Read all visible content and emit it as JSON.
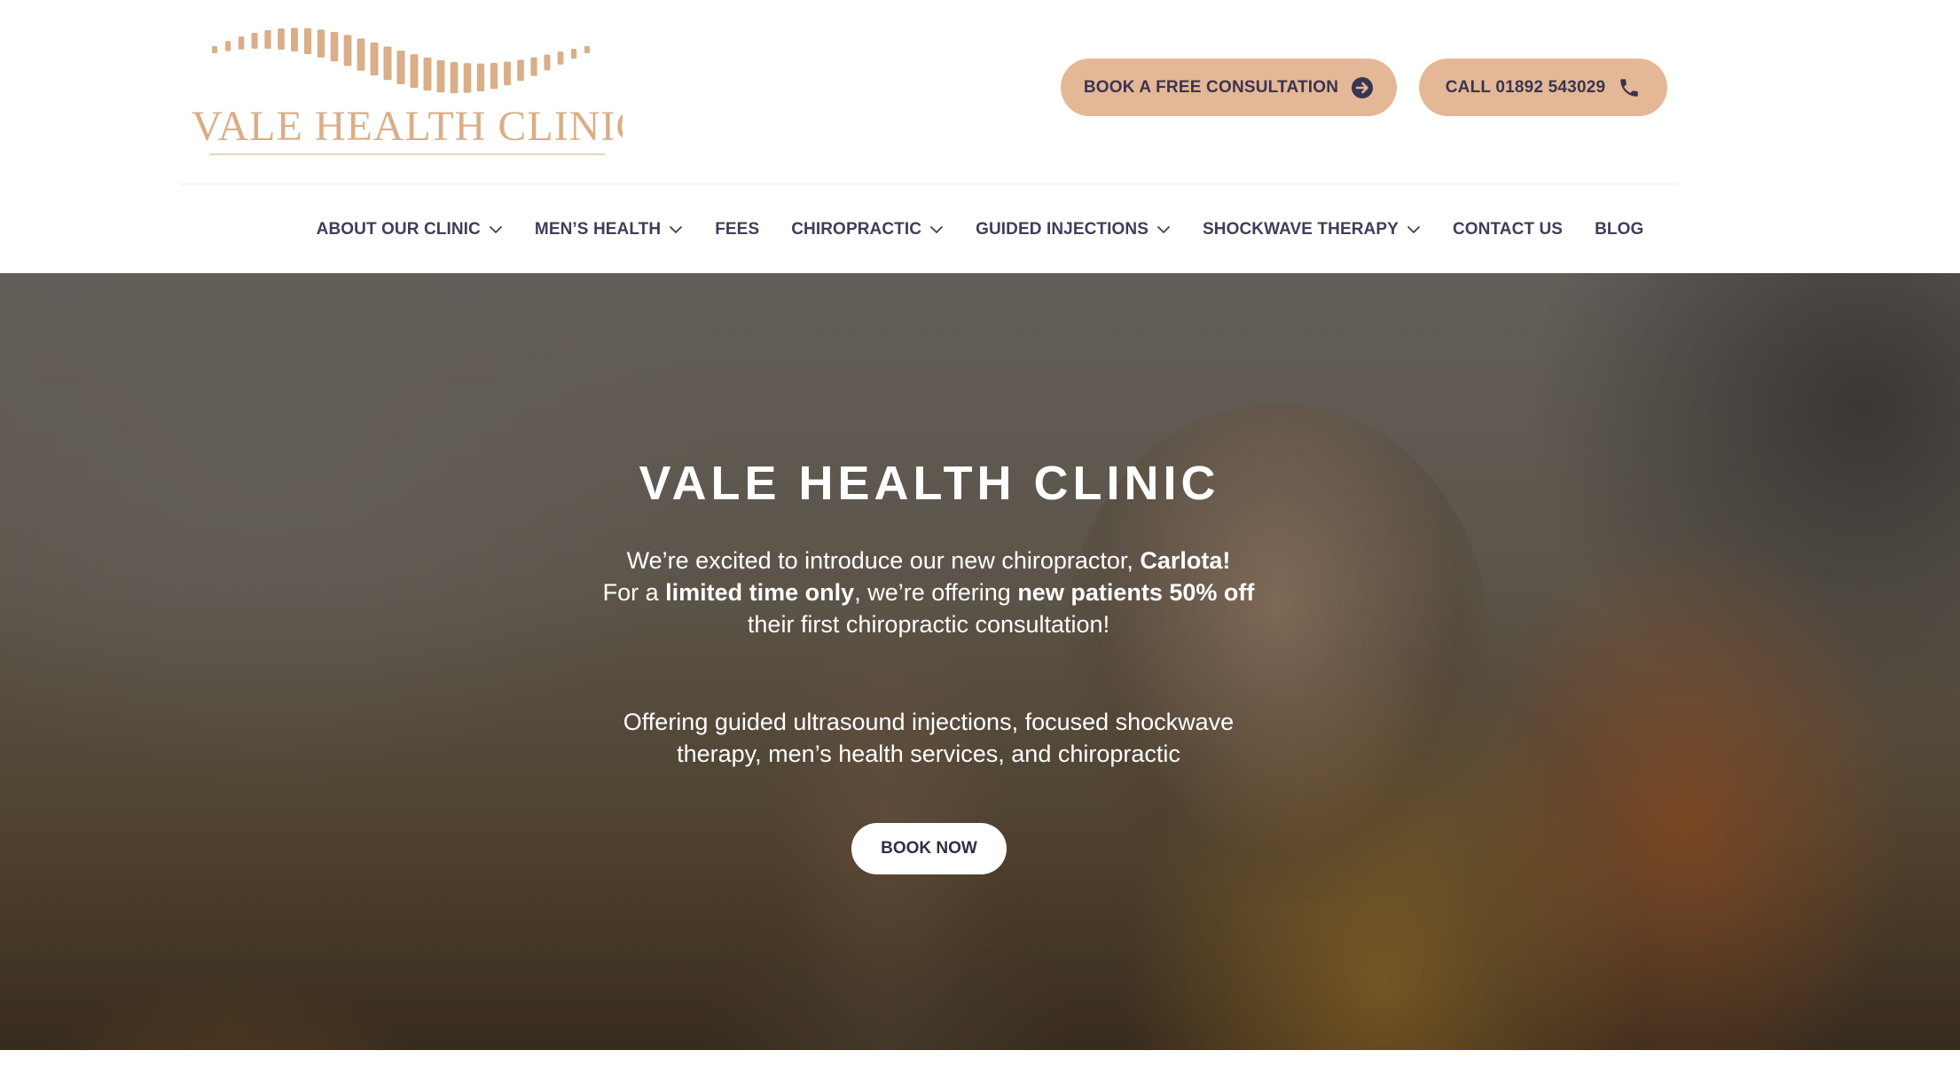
{
  "brand": {
    "name": "VALE HEALTH CLINIC",
    "color": "#e4b896",
    "logo_text_color": "#d9ae88"
  },
  "header": {
    "consult_button": {
      "label": "BOOK A FREE CONSULTATION",
      "icon": "arrow-right-circle-icon"
    },
    "call_button": {
      "label": "CALL 01892 543029",
      "icon": "phone-icon"
    }
  },
  "nav": {
    "items": [
      {
        "label": "ABOUT OUR CLINIC",
        "dropdown": true
      },
      {
        "label": "MEN’S HEALTH",
        "dropdown": true
      },
      {
        "label": "FEES",
        "dropdown": false
      },
      {
        "label": "CHIROPRACTIC",
        "dropdown": true
      },
      {
        "label": "GUIDED INJECTIONS",
        "dropdown": true
      },
      {
        "label": "SHOCKWAVE THERAPY",
        "dropdown": true
      },
      {
        "label": "CONTACT US",
        "dropdown": false
      },
      {
        "label": "BLOG",
        "dropdown": false
      }
    ]
  },
  "hero": {
    "title": "VALE HEALTH CLINIC",
    "intro": {
      "p1": "We’re excited to introduce our new chiropractor, ",
      "b1": "Carlota!",
      "p2": "For a ",
      "b2": "limited time only",
      "p3": ", we’re offering ",
      "b3": "new patients 50% off",
      "p4": " their first chiropractic consultation!"
    },
    "services": "Offering guided ultrasound injections, focused shockwave therapy, men’s health services, and chiropractic",
    "cta_label": "BOOK NOW"
  },
  "colors": {
    "nav_text": "#3e3e5a",
    "button_text": "#3b3450"
  }
}
